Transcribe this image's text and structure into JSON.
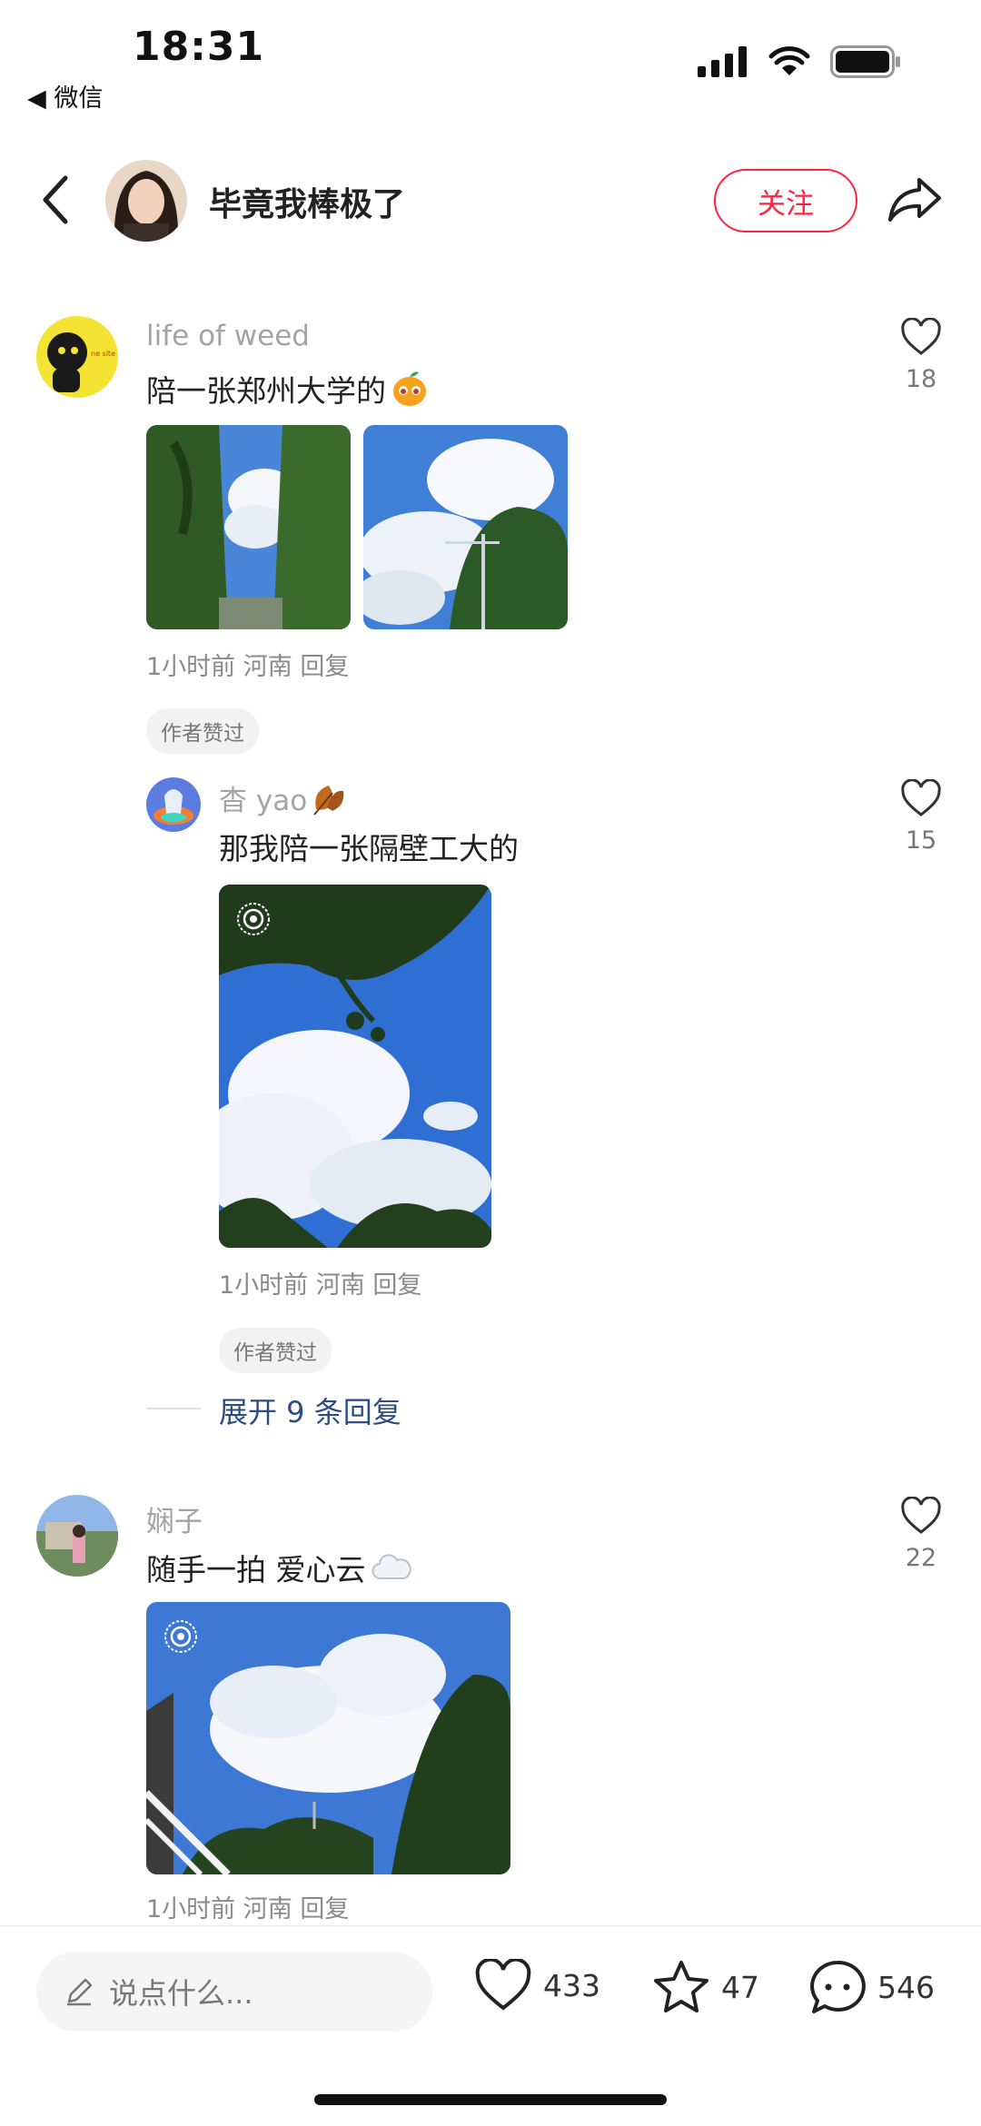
{
  "status_bar": {
    "time": "18:31",
    "back_app": "◀ 微信"
  },
  "header": {
    "author_name": "毕竟我棒极了",
    "follow_label": "关注"
  },
  "comments": [
    {
      "user": "life of weed",
      "text": "陪一张郑州大学的",
      "likes": "18",
      "meta": "1小时前 河南 回复",
      "badge": "作者赞过"
    },
    {
      "user": "杳 yao",
      "text": "那我陪一张隔壁工大的",
      "likes": "15",
      "meta": "1小时前 河南 回复",
      "badge": "作者赞过"
    },
    {
      "user": "娴子",
      "text": "随手一拍 爱心云",
      "likes": "22",
      "meta": "1小时前 河南 回复"
    }
  ],
  "expand_replies": "展开 9 条回复",
  "bottom_bar": {
    "input_placeholder": "说点什么...",
    "like_count": "433",
    "star_count": "47",
    "comment_count": "546"
  }
}
